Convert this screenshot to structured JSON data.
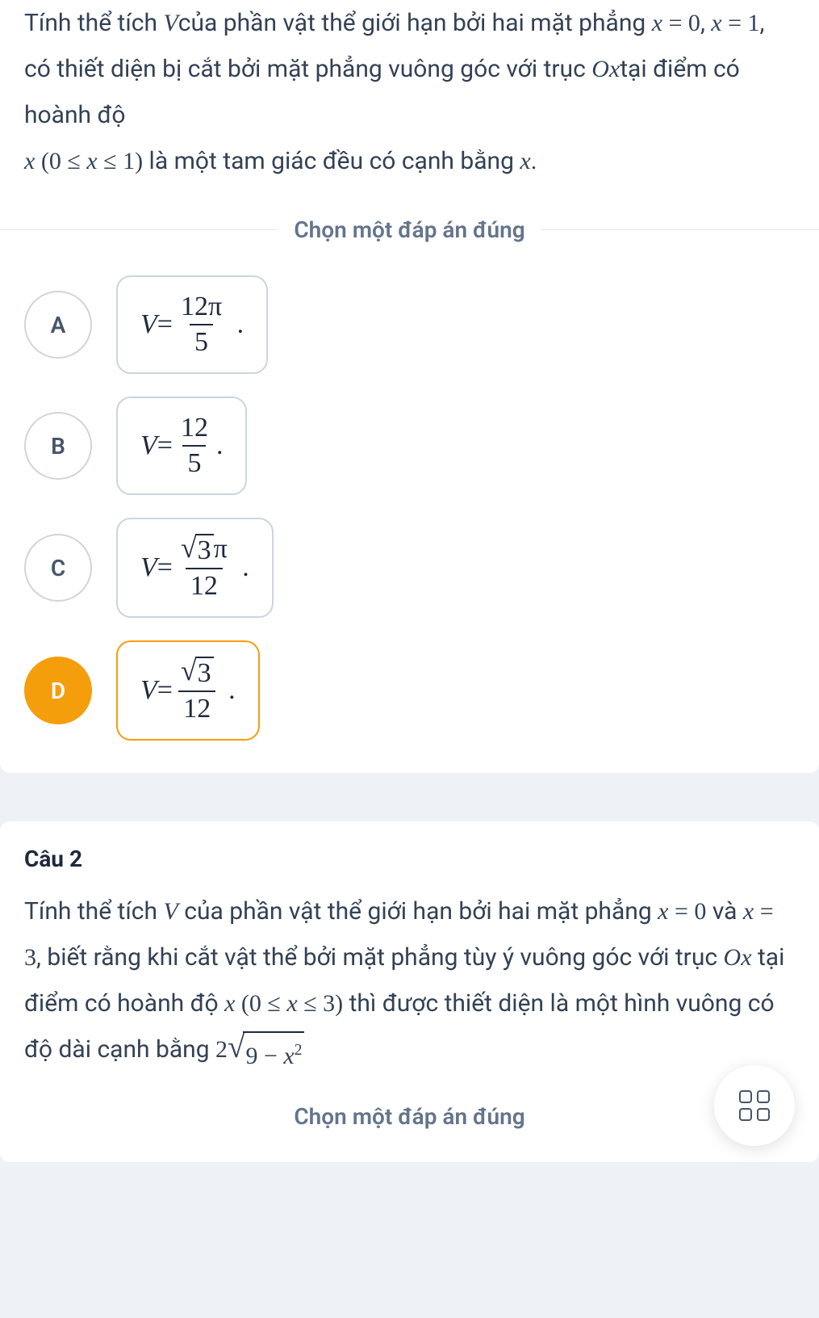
{
  "q1": {
    "text_parts": {
      "p1": "Tính thể tích ",
      "V": "V",
      "p2": "của phần vật thể giới hạn bởi hai mặt phẳng ",
      "eq1a": "x",
      "eq1b": " = 0",
      "comma": ",  ",
      "eq2a": "x",
      "eq2b": " = 1",
      "p3": ", có thiết diện bị cắt bởi mặt phẳng vuông góc với trục ",
      "Ox": "Ox",
      "p4": "tại điểm có hoành độ ",
      "x": "x",
      "range_open": "  (0 ≤ ",
      "range_x": "x",
      "range_close": " ≤ 1)",
      "p5": " là một tam giác đều có cạnh bằng ",
      "xend": "x",
      "period": "."
    },
    "prompt": "Chọn một đáp án đúng",
    "options": {
      "A": {
        "label": "A",
        "num": "12π",
        "den": "5"
      },
      "B": {
        "label": "B",
        "num": "12",
        "den": "5"
      },
      "C": {
        "label": "C",
        "num_sqrt": "3",
        "num_suffix": "π",
        "den": "12"
      },
      "D": {
        "label": "D",
        "num_sqrt": "3",
        "den": "12",
        "selected": true
      }
    }
  },
  "q2": {
    "label": "Câu 2",
    "text_parts": {
      "p1": "Tính thể tích ",
      "V": "V",
      "p2": " của phần vật thể giới hạn bởi hai mặt phẳng ",
      "eq1a": "x",
      "eq1b": " = 0",
      "and": " và ",
      "eq2a": "x",
      "eq2b": " = 3",
      "p3": ", biết rằng khi cắt vật thể bởi mặt phẳng tùy ý vuông góc với trục ",
      "Ox": "Ox",
      "p4": " tại điểm có hoành độ ",
      "x": "x",
      "range": " (0 ≤ ",
      "range_x": "x",
      "range_close": " ≤ 3)",
      "p5": " thì được thiết diện là một hình vuông có độ dài cạnh bằng ",
      "coef": "2",
      "radicand_a": "9 − ",
      "radicand_x": "x",
      "exp": "2"
    },
    "prompt": "Chọn một đáp án đúng"
  },
  "math": {
    "Veq": "V",
    "eq": " = "
  }
}
